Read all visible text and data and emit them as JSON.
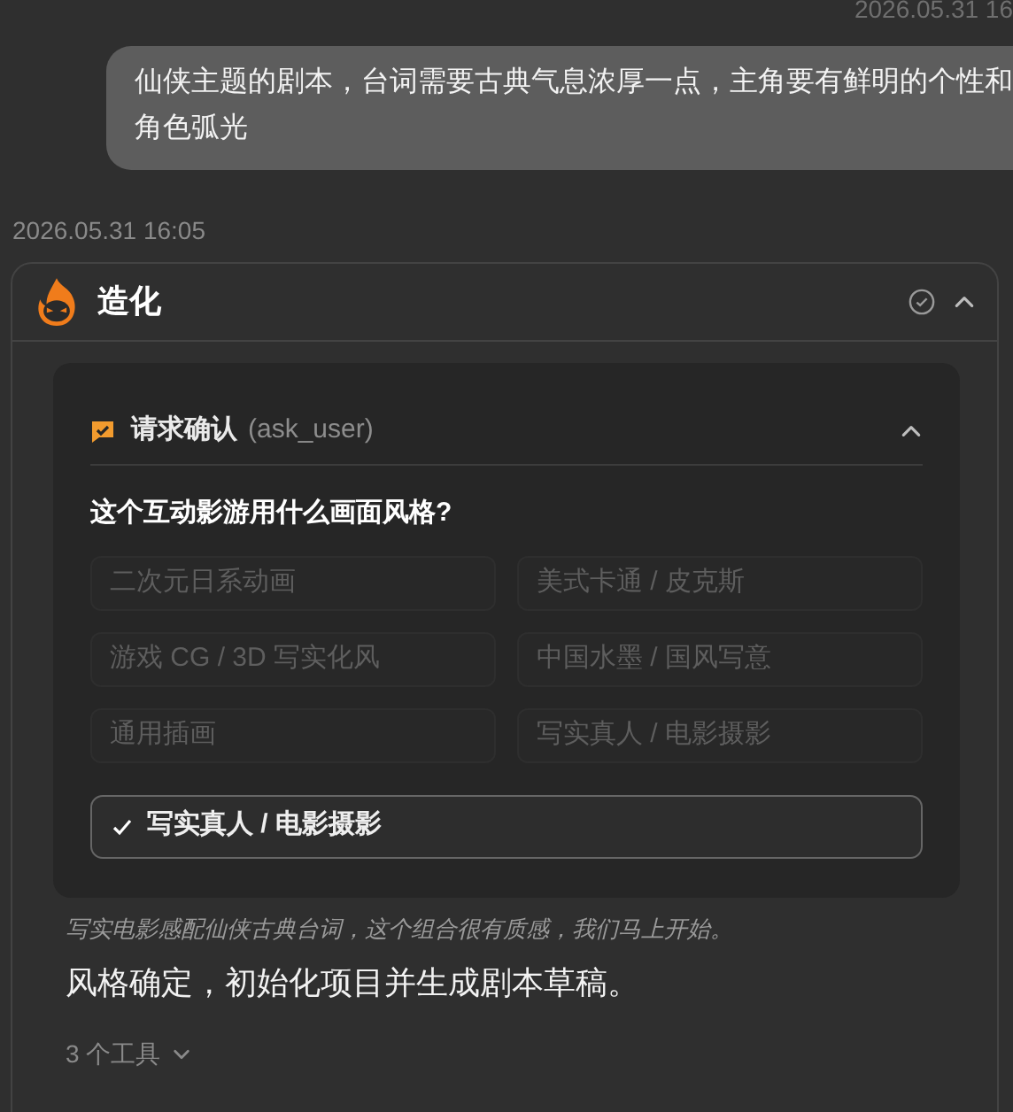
{
  "user_message": {
    "time": "2026.05.31 16",
    "text": "仙侠主题的剧本，台词需要古典气息浓厚一点，主角要有鲜明的个性和角色弧光"
  },
  "agent_message": {
    "time": "2026.05.31 16:05",
    "name": "造化",
    "expanded": true,
    "ask_user": {
      "title": "请求确认",
      "tool": "(ask_user)",
      "expanded": true,
      "question": "这个互动影游用什么画面风格?",
      "options": [
        {
          "label": "二次元日系动画",
          "disabled": true
        },
        {
          "label": "美式卡通 / 皮克斯",
          "disabled": true
        },
        {
          "label": "游戏 CG / 3D 写实化风",
          "disabled": true
        },
        {
          "label": "中国水墨 / 国风写意",
          "disabled": true
        },
        {
          "label": "通用插画",
          "disabled": true
        },
        {
          "label": "写实真人 / 电影摄影",
          "disabled": true
        }
      ],
      "answer": {
        "label": "写实真人 / 电影摄影",
        "checked": true
      }
    },
    "note": "写实电影感配仙侠古典台词，这个组合很有质感，我们马上开始。",
    "body": "风格确定，初始化项目并生成剧本草稿。",
    "tools": {
      "label": "3 个工具",
      "expanded": false
    }
  }
}
